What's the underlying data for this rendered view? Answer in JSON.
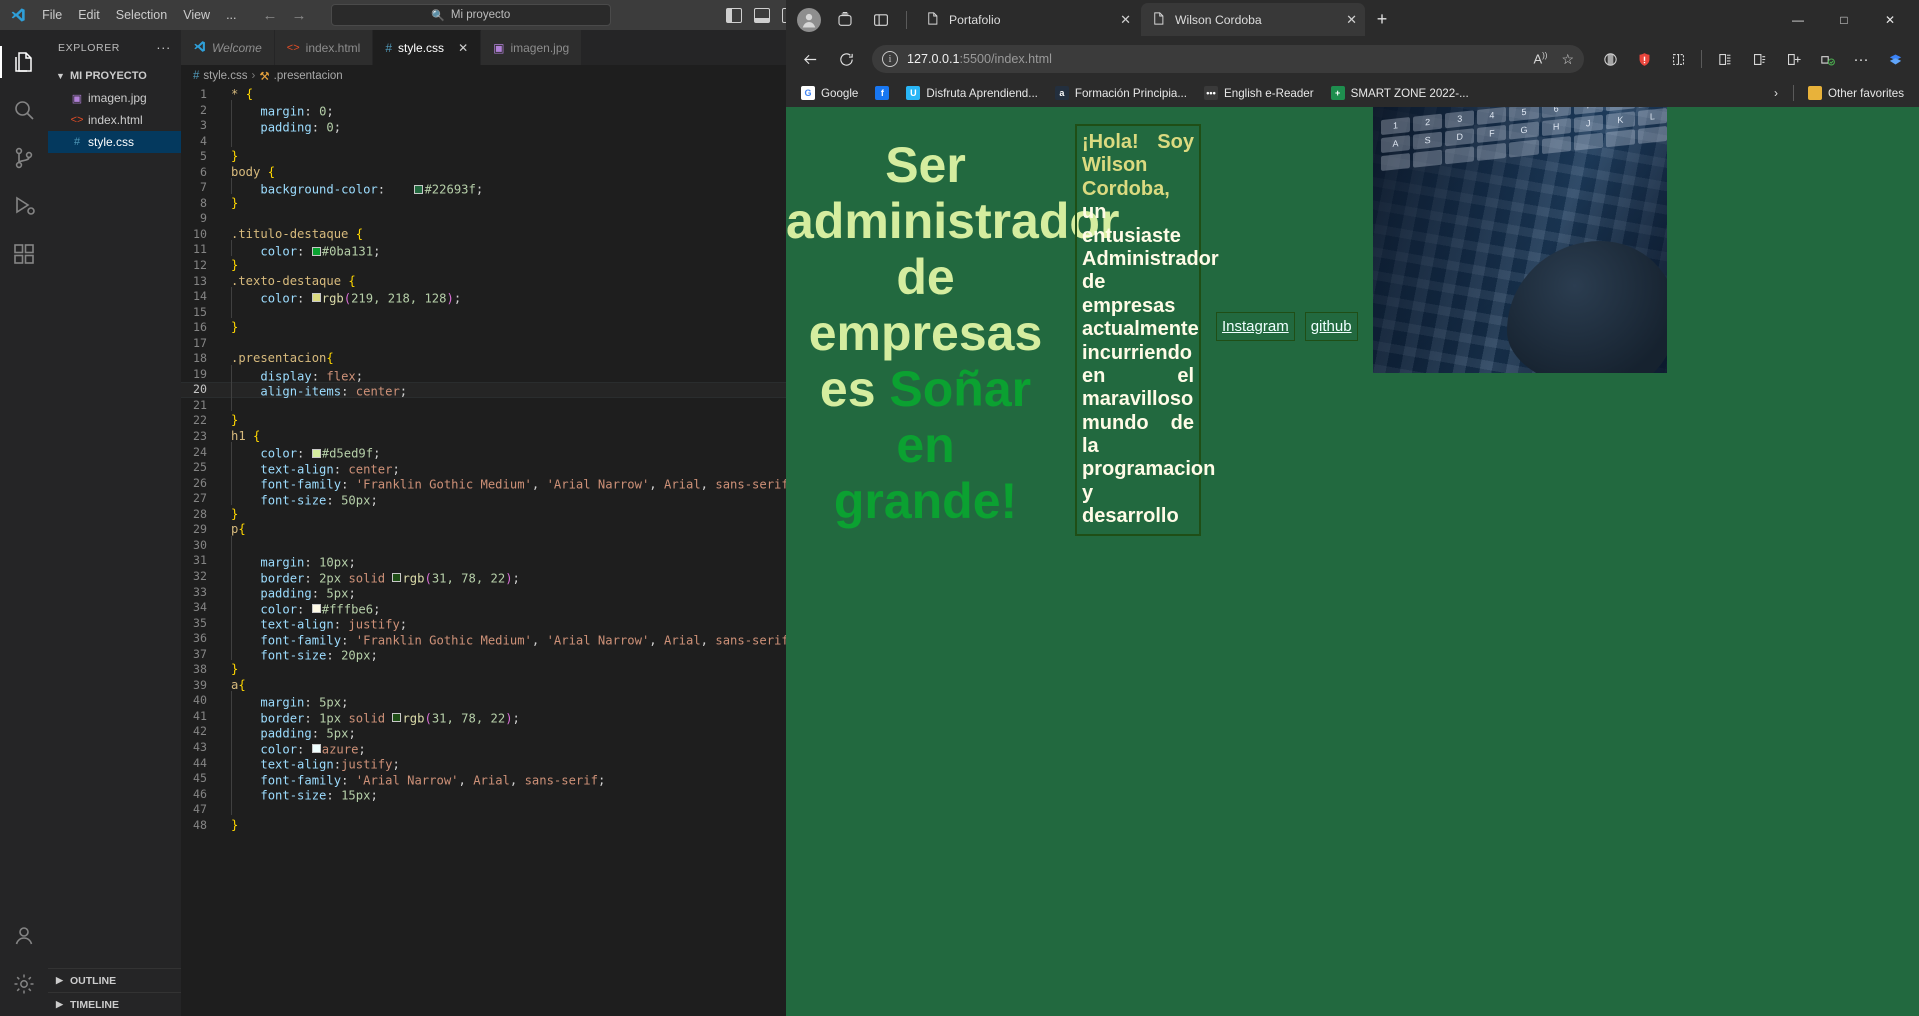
{
  "vscode": {
    "titlebar": {
      "menu": [
        "File",
        "Edit",
        "Selection",
        "View",
        "..."
      ],
      "back_icon": "back-arrow-icon",
      "forward_icon": "forward-arrow-icon",
      "search_placeholder": "Mi proyecto",
      "search_icon": "search-icon",
      "minimize": "—",
      "maximize": "□",
      "close": "✕"
    },
    "activitybar": [
      {
        "name": "explorer",
        "icon": "files-icon",
        "active": true
      },
      {
        "name": "search",
        "icon": "search-icon",
        "active": false
      },
      {
        "name": "source-control",
        "icon": "source-control-icon",
        "active": false
      },
      {
        "name": "run-and-debug",
        "icon": "run-debug-icon",
        "active": false
      },
      {
        "name": "extensions",
        "icon": "extensions-icon",
        "active": false
      },
      {
        "name": "accounts",
        "icon": "account-icon",
        "active": false
      },
      {
        "name": "settings",
        "icon": "gear-icon",
        "active": false
      }
    ],
    "sidebar": {
      "title": "EXPLORER",
      "more_label": "···",
      "root": "MI PROYECTO",
      "files": [
        {
          "name": "imagen.jpg",
          "icon": "image-file-icon",
          "selected": false
        },
        {
          "name": "index.html",
          "icon": "html-file-icon",
          "selected": false
        },
        {
          "name": "style.css",
          "icon": "css-file-icon",
          "selected": true
        }
      ],
      "footer": [
        "OUTLINE",
        "TIMELINE"
      ]
    },
    "tabs": [
      {
        "label": "Welcome",
        "icon": "vscode-logo-icon",
        "active": false,
        "italic": true,
        "closable": false
      },
      {
        "label": "index.html",
        "icon": "html-file-icon",
        "active": false,
        "italic": false,
        "closable": false
      },
      {
        "label": "style.css",
        "icon": "css-file-icon",
        "active": true,
        "italic": false,
        "closable": true
      },
      {
        "label": "imagen.jpg",
        "icon": "image-file-icon",
        "active": false,
        "italic": false,
        "closable": false
      }
    ],
    "tab_actions": [
      "split-editor-icon",
      "more-actions-icon"
    ],
    "breadcrumb": {
      "file": "style.css",
      "separator": "›",
      "symbol": ".presentacion"
    },
    "active_line": 20,
    "code": [
      {
        "n": 1,
        "indent": 0,
        "html": "<span class='c-sel'>*</span> <span class='c-brace'>{</span>"
      },
      {
        "n": 2,
        "indent": 1,
        "html": "    <span class='c-prop'>margin</span><span class='c-punct'>:</span> <span class='c-num'>0</span><span class='c-punct'>;</span>"
      },
      {
        "n": 3,
        "indent": 1,
        "html": "    <span class='c-prop'>padding</span><span class='c-punct'>:</span> <span class='c-num'>0</span><span class='c-punct'>;</span>"
      },
      {
        "n": 4,
        "indent": 1,
        "html": ""
      },
      {
        "n": 5,
        "indent": 0,
        "html": "<span class='c-brace'>}</span>"
      },
      {
        "n": 6,
        "indent": 0,
        "html": "<span class='c-sel'>body</span> <span class='c-brace'>{</span>"
      },
      {
        "n": 7,
        "indent": 1,
        "html": "    <span class='c-prop'>background-color</span><span class='c-punct'>:</span>    <span class='swatch' style='background:#22693f'></span><span class='c-num'>#22693f</span><span class='c-punct'>;</span>"
      },
      {
        "n": 8,
        "indent": 0,
        "html": "<span class='c-brace'>}</span>"
      },
      {
        "n": 9,
        "indent": 0,
        "html": ""
      },
      {
        "n": 10,
        "indent": 0,
        "html": "<span class='c-sel'>.titulo-destaque</span> <span class='c-brace'>{</span>"
      },
      {
        "n": 11,
        "indent": 1,
        "html": "    <span class='c-prop'>color</span><span class='c-punct'>:</span> <span class='swatch' style='background:#0ba131'></span><span class='c-num'>#0ba131</span><span class='c-punct'>;</span>"
      },
      {
        "n": 12,
        "indent": 0,
        "html": "<span class='c-brace'>}</span>"
      },
      {
        "n": 13,
        "indent": 0,
        "html": "<span class='c-sel'>.texto-destaque</span> <span class='c-brace'>{</span>"
      },
      {
        "n": 14,
        "indent": 1,
        "html": "    <span class='c-prop'>color</span><span class='c-punct'>:</span> <span class='swatch' style='background:rgb(219,218,128)'></span><span class='c-fn'>rgb</span><span class='c-paren'>(</span><span class='c-num'>219, 218, 128</span><span class='c-paren'>)</span><span class='c-punct'>;</span>"
      },
      {
        "n": 15,
        "indent": 1,
        "html": ""
      },
      {
        "n": 16,
        "indent": 0,
        "html": "<span class='c-brace'>}</span>"
      },
      {
        "n": 17,
        "indent": 0,
        "html": ""
      },
      {
        "n": 18,
        "indent": 0,
        "html": "<span class='c-sel'>.presentacion</span><span class='c-brace'>{</span>"
      },
      {
        "n": 19,
        "indent": 1,
        "html": "    <span class='c-prop'>display</span><span class='c-punct'>:</span> <span class='c-val2'>flex</span><span class='c-punct'>;</span>"
      },
      {
        "n": 20,
        "indent": 1,
        "html": "    <span class='c-prop'>align-items</span><span class='c-punct'>:</span> <span class='c-val2'>center</span><span class='c-punct'>;</span>"
      },
      {
        "n": 21,
        "indent": 1,
        "html": ""
      },
      {
        "n": 22,
        "indent": 0,
        "html": "<span class='c-brace'>}</span>"
      },
      {
        "n": 23,
        "indent": 0,
        "html": "<span class='c-sel'>h1</span> <span class='c-brace'>{</span>"
      },
      {
        "n": 24,
        "indent": 1,
        "html": "    <span class='c-prop'>color</span><span class='c-punct'>:</span> <span class='swatch' style='background:#d5ed9f'></span><span class='c-num'>#d5ed9f</span><span class='c-punct'>;</span>"
      },
      {
        "n": 25,
        "indent": 1,
        "html": "    <span class='c-prop'>text-align</span><span class='c-punct'>:</span> <span class='c-val2'>center</span><span class='c-punct'>;</span>"
      },
      {
        "n": 26,
        "indent": 1,
        "html": "    <span class='c-prop'>font-family</span><span class='c-punct'>:</span> <span class='c-val'>'Franklin Gothic Medium'</span><span class='c-punct'>,</span> <span class='c-val'>'Arial Narrow'</span><span class='c-punct'>,</span> <span class='c-val2'>Arial</span><span class='c-punct'>,</span> <span class='c-val2'>sans-serif</span>"
      },
      {
        "n": 27,
        "indent": 1,
        "html": "    <span class='c-prop'>font-size</span><span class='c-punct'>:</span> <span class='c-num'>50px</span><span class='c-punct'>;</span>"
      },
      {
        "n": 28,
        "indent": 0,
        "html": "<span class='c-brace'>}</span>"
      },
      {
        "n": 29,
        "indent": 0,
        "html": "<span class='c-sel'>p</span><span class='c-brace'>{</span>"
      },
      {
        "n": 30,
        "indent": 1,
        "html": ""
      },
      {
        "n": 31,
        "indent": 1,
        "html": "    <span class='c-prop'>margin</span><span class='c-punct'>:</span> <span class='c-num'>10px</span><span class='c-punct'>;</span>"
      },
      {
        "n": 32,
        "indent": 1,
        "html": "    <span class='c-prop'>border</span><span class='c-punct'>:</span> <span class='c-num'>2px</span> <span class='c-val2'>solid</span> <span class='swatch' style='background:rgb(31,78,22)'></span><span class='c-fn'>rgb</span><span class='c-paren'>(</span><span class='c-num'>31, 78, 22</span><span class='c-paren'>)</span><span class='c-punct'>;</span>"
      },
      {
        "n": 33,
        "indent": 1,
        "html": "    <span class='c-prop'>padding</span><span class='c-punct'>:</span> <span class='c-num'>5px</span><span class='c-punct'>;</span>"
      },
      {
        "n": 34,
        "indent": 1,
        "html": "    <span class='c-prop'>color</span><span class='c-punct'>:</span> <span class='swatch' style='background:#fffbe6'></span><span class='c-num'>#fffbe6</span><span class='c-punct'>;</span>"
      },
      {
        "n": 35,
        "indent": 1,
        "html": "    <span class='c-prop'>text-align</span><span class='c-punct'>:</span> <span class='c-val2'>justify</span><span class='c-punct'>;</span>"
      },
      {
        "n": 36,
        "indent": 1,
        "html": "    <span class='c-prop'>font-family</span><span class='c-punct'>:</span> <span class='c-val'>'Franklin Gothic Medium'</span><span class='c-punct'>,</span> <span class='c-val'>'Arial Narrow'</span><span class='c-punct'>,</span> <span class='c-val2'>Arial</span><span class='c-punct'>,</span> <span class='c-val2'>sans-serif</span>"
      },
      {
        "n": 37,
        "indent": 1,
        "html": "    <span class='c-prop'>font-size</span><span class='c-punct'>:</span> <span class='c-num'>20px</span><span class='c-punct'>;</span>"
      },
      {
        "n": 38,
        "indent": 0,
        "html": "<span class='c-brace'>}</span>"
      },
      {
        "n": 39,
        "indent": 0,
        "html": "<span class='c-sel'>a</span><span class='c-brace'>{</span>"
      },
      {
        "n": 40,
        "indent": 1,
        "html": "    <span class='c-prop'>margin</span><span class='c-punct'>:</span> <span class='c-num'>5px</span><span class='c-punct'>;</span>"
      },
      {
        "n": 41,
        "indent": 1,
        "html": "    <span class='c-prop'>border</span><span class='c-punct'>:</span> <span class='c-num'>1px</span> <span class='c-val2'>solid</span> <span class='swatch' style='background:rgb(31,78,22)'></span><span class='c-fn'>rgb</span><span class='c-paren'>(</span><span class='c-num'>31, 78, 22</span><span class='c-paren'>)</span><span class='c-punct'>;</span>"
      },
      {
        "n": 42,
        "indent": 1,
        "html": "    <span class='c-prop'>padding</span><span class='c-punct'>:</span> <span class='c-num'>5px</span><span class='c-punct'>;</span>"
      },
      {
        "n": 43,
        "indent": 1,
        "html": "    <span class='c-prop'>color</span><span class='c-punct'>:</span> <span class='swatch' style='background:#f0ffff'></span><span class='c-val2'>azure</span><span class='c-punct'>;</span>"
      },
      {
        "n": 44,
        "indent": 1,
        "html": "    <span class='c-prop'>text-align</span><span class='c-punct'>:</span><span class='c-val2'>justify</span><span class='c-punct'>;</span>"
      },
      {
        "n": 45,
        "indent": 1,
        "html": "    <span class='c-prop'>font-family</span><span class='c-punct'>:</span> <span class='c-val'>'Arial Narrow'</span><span class='c-punct'>,</span> <span class='c-val2'>Arial</span><span class='c-punct'>,</span> <span class='c-val2'>sans-serif</span><span class='c-punct'>;</span>"
      },
      {
        "n": 46,
        "indent": 1,
        "html": "    <span class='c-prop'>font-size</span><span class='c-punct'>:</span> <span class='c-num'>15px</span><span class='c-punct'>;</span>"
      },
      {
        "n": 47,
        "indent": 1,
        "html": ""
      },
      {
        "n": 48,
        "indent": 0,
        "html": "<span class='c-brace'>}</span>"
      }
    ]
  },
  "edge": {
    "tabstrip": {
      "profile_icon": "account-avatar-icon",
      "workspaces_icon": "workspaces-icon",
      "tab_actions_icon": "tab-actions-menu-icon",
      "new_tab_label": "+",
      "minimize": "—",
      "maximize": "□",
      "close": "✕"
    },
    "tabs": [
      {
        "label": "Portafolio",
        "active": false,
        "close": "✕"
      },
      {
        "label": "Wilson Cordoba",
        "active": true,
        "close": "✕"
      }
    ],
    "navbar": {
      "back_icon": "back-arrow-icon",
      "reload_icon": "reload-icon",
      "info_icon": "site-info-icon",
      "url_host": "127.0.0.1",
      "url_path": ":5500/index.html",
      "read_aloud_icon": "read-aloud-icon",
      "favorite_icon": "star-icon",
      "split_screen_icon": "split-screen-icon",
      "shield_icon": "tracking-prevention-icon",
      "collections_icon": "collections-icon",
      "browser_essentials_icon": "browser-essentials-icon",
      "add_icon": "add-to-icon",
      "extensions_icon": "extensions-check-icon",
      "settings_more_icon": "settings-and-more-icon",
      "copilot_icon": "copilot-icon"
    },
    "bookmarks": [
      {
        "label": "Google",
        "icon_text": "G",
        "color": "#ffffff"
      },
      {
        "label": "",
        "icon_text": "f",
        "color": "#1877f2"
      },
      {
        "label": "Disfruta Aprendiend...",
        "icon_text": "U",
        "color": "#29b6f6"
      },
      {
        "label": "Formación Principia...",
        "icon_text": "a",
        "color": "#232f3e"
      },
      {
        "label": "English e-Reader",
        "icon_text": "•••",
        "color": "#3a3a3a"
      },
      {
        "label": "SMART ZONE 2022-...",
        "icon_text": "+",
        "color": "#1e8e4e"
      }
    ],
    "bookmarks_overflow": "›",
    "other_favorites": {
      "label": "Other favorites",
      "icon": "folder-icon"
    }
  },
  "page": {
    "heading": {
      "line1": "Ser",
      "line2": "administrador",
      "line3": "de empresas",
      "line4_plain": "es ",
      "line4_highlight": "Soñar en",
      "line5_highlight": "grande!"
    },
    "bio": {
      "highlight": "¡Hola! Soy Wilson Cordoba,",
      "rest": " un entusiaste Administrador de empresas actualmente incurriendo en el maravilloso mundo de la programacion y desarrollo"
    },
    "links": [
      {
        "label": "Instagram"
      },
      {
        "label": "github"
      }
    ],
    "image": {
      "alt": "imagen.jpg",
      "name": "laptop-keyboard-photo"
    },
    "colors": {
      "background": "#22693f",
      "heading": "#d5ed9f",
      "heading_highlight": "#0ba131",
      "bio_text": "#fffbe6",
      "bio_highlight": "rgb(219, 218, 128)",
      "border": "rgb(31, 78, 22)",
      "link": "azure"
    }
  }
}
